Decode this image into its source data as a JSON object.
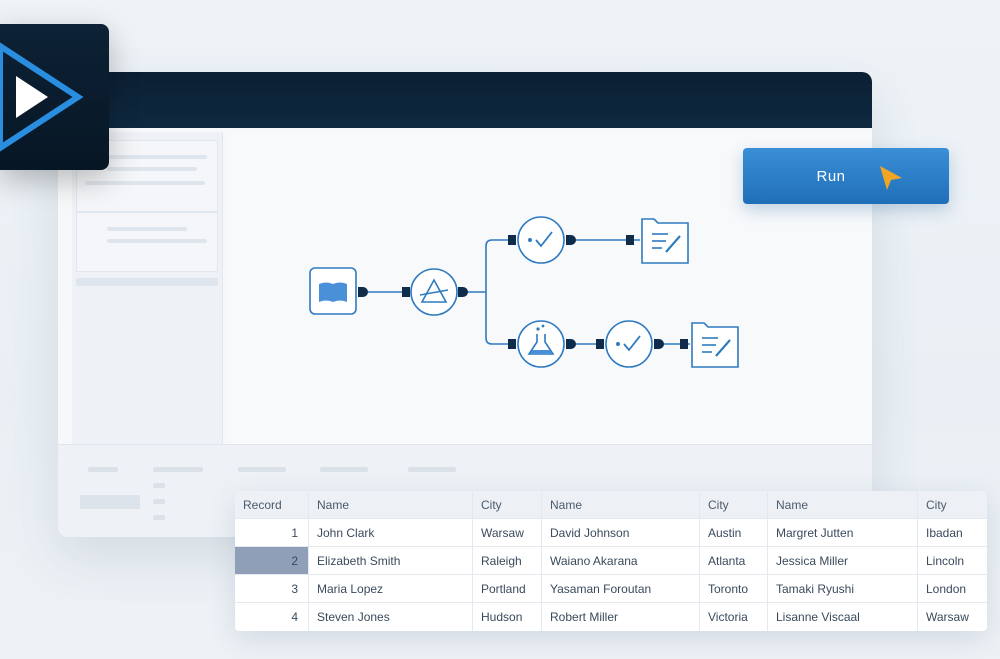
{
  "run_button": {
    "label": "Run"
  },
  "icons": {
    "logo": "play-logo-icon",
    "cursor": "cursor-arrow-icon",
    "input": "book-icon",
    "prep": "prism-icon",
    "check1": "check-circle-icon",
    "output1": "folder-edit-icon",
    "lab": "flask-icon",
    "check2": "check-circle-icon",
    "output2": "folder-edit-icon"
  },
  "colors": {
    "accent": "#2a7fc9",
    "titlebar": "#0b1f33",
    "node_stroke": "#2f7bbf",
    "connector": "#0f2d4a"
  },
  "table": {
    "headers": [
      "Record",
      "Name",
      "City",
      "Name",
      "City",
      "Name",
      "City"
    ],
    "rows": [
      [
        "1",
        "John Clark",
        "Warsaw",
        "David Johnson",
        "Austin",
        "Margret Jutten",
        "Ibadan"
      ],
      [
        "2",
        "Elizabeth Smith",
        "Raleigh",
        "Waiano Akarana",
        "Atlanta",
        "Jessica Miller",
        "Lincoln"
      ],
      [
        "3",
        "Maria Lopez",
        "Portland",
        "Yasaman Foroutan",
        "Toronto",
        "Tamaki Ryushi",
        "London"
      ],
      [
        "4",
        "Steven Jones",
        "Hudson",
        "Robert Miller",
        "Victoria",
        "Lisanne Viscaal",
        "Warsaw"
      ]
    ],
    "selected_record": "2"
  }
}
